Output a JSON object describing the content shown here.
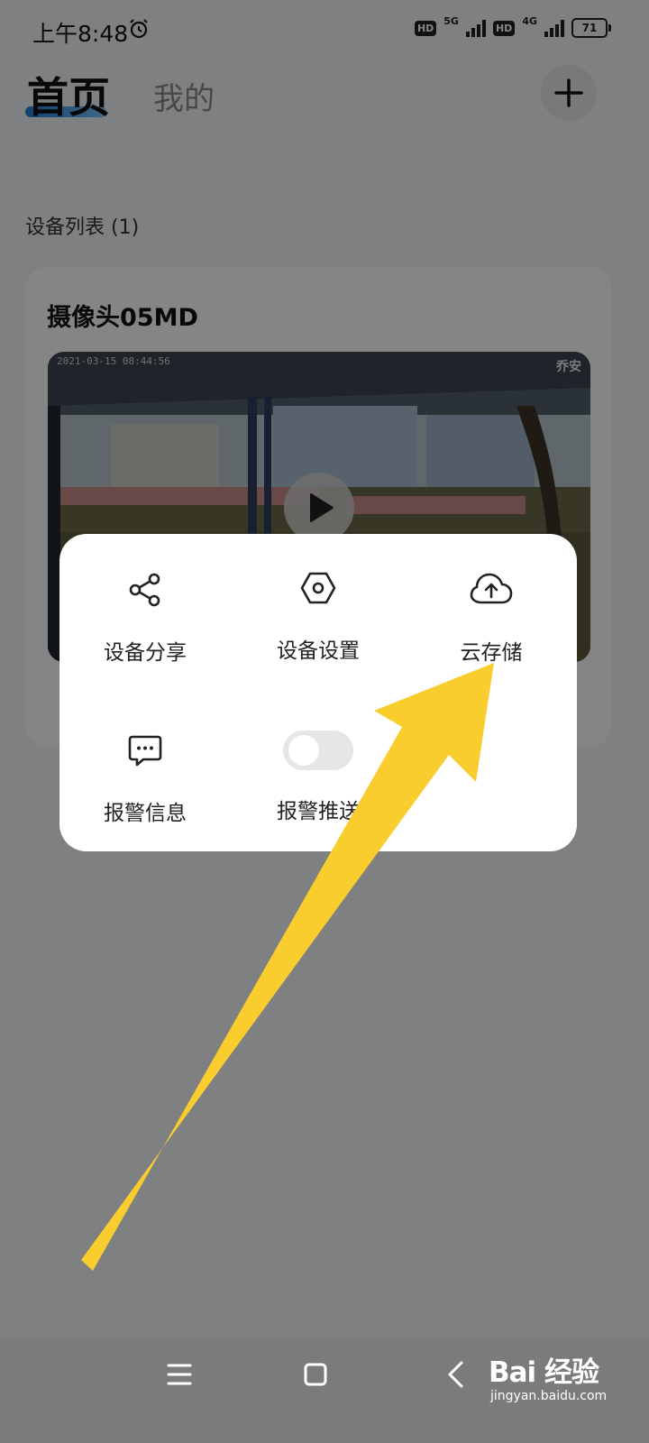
{
  "status_bar": {
    "time": "上午8:48",
    "hd1": "HD",
    "network1": "5G",
    "hd2": "HD",
    "network2": "4G",
    "battery": "71"
  },
  "header": {
    "tab_home": "首页",
    "tab_mine": "我的"
  },
  "device_list": {
    "title": "设备列表 (1)",
    "devices": [
      {
        "name": "摄像头05MD",
        "timestamp": "2021-03-15 08:44:56",
        "brand": "乔安"
      }
    ]
  },
  "popup_menu": {
    "items": [
      {
        "label": "设备分享",
        "icon": "share-icon"
      },
      {
        "label": "设备设置",
        "icon": "settings-icon"
      },
      {
        "label": "云存储",
        "icon": "cloud-upload-icon"
      },
      {
        "label": "报警信息",
        "icon": "message-icon"
      },
      {
        "label": "报警推送",
        "icon": "toggle-switch",
        "toggle_on": false
      }
    ]
  },
  "annotation": {
    "arrow_color": "#f9cd2e"
  },
  "watermark": {
    "text": "Bai 经验",
    "sub": "jingyan.baidu.com"
  },
  "colors": {
    "accent": "#1f7fe0",
    "overlay": "rgba(0,0,0,0.48)"
  }
}
